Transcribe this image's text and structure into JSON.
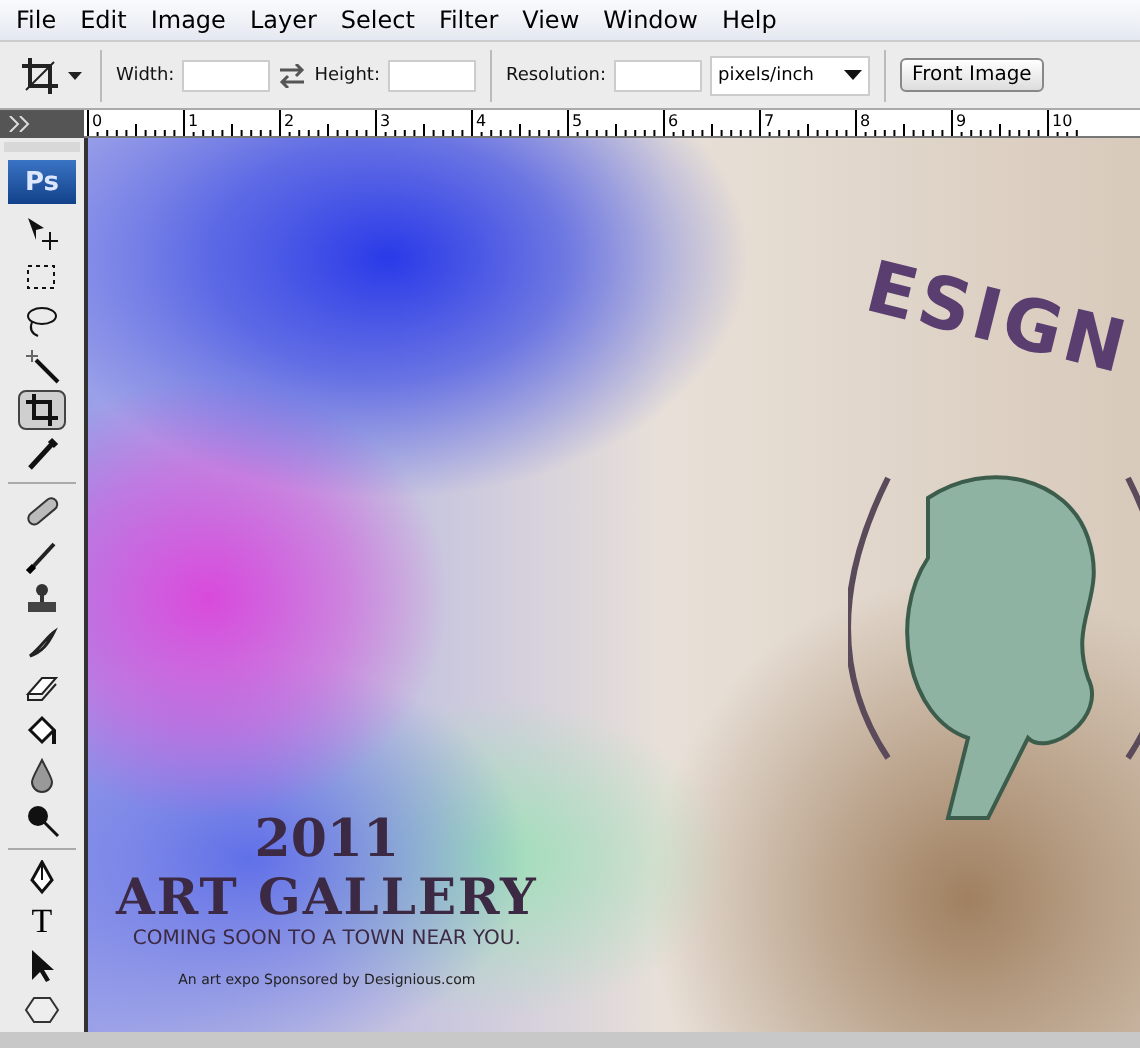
{
  "menu": [
    "File",
    "Edit",
    "Image",
    "Layer",
    "Select",
    "Filter",
    "View",
    "Window",
    "Help"
  ],
  "options_bar": {
    "width_label": "Width:",
    "height_label": "Height:",
    "resolution_label": "Resolution:",
    "units": "pixels/inch",
    "button": "Front Image"
  },
  "ruler": [
    "0",
    "1",
    "2",
    "3",
    "4",
    "5",
    "6",
    "7",
    "8",
    "9",
    "10"
  ],
  "toolbox": {
    "logo": "Ps",
    "groups": [
      {
        "tools": [
          {
            "selected": false
          },
          {
            "selected": false
          },
          {
            "selected": false
          },
          {
            "selected": false
          },
          {
            "selected": true
          },
          {
            "selected": false
          }
        ]
      },
      {
        "tools": [
          {
            "selected": false
          },
          {
            "selected": false
          },
          {
            "selected": false
          },
          {
            "selected": false
          },
          {
            "selected": false
          },
          {
            "selected": false
          },
          {
            "selected": false
          },
          {
            "selected": false
          }
        ]
      },
      {
        "tools": [
          {
            "selected": false
          },
          {
            "label": "T",
            "selected": false
          },
          {
            "selected": false
          },
          {
            "selected": false
          }
        ]
      }
    ]
  },
  "canvas": {
    "corner_title": "ESIGN",
    "year": "2011",
    "headline": "ART GALLERY",
    "tagline": "COMING SOON TO A TOWN NEAR YOU.",
    "credit": "An art expo Sponsored by Designious.com"
  }
}
